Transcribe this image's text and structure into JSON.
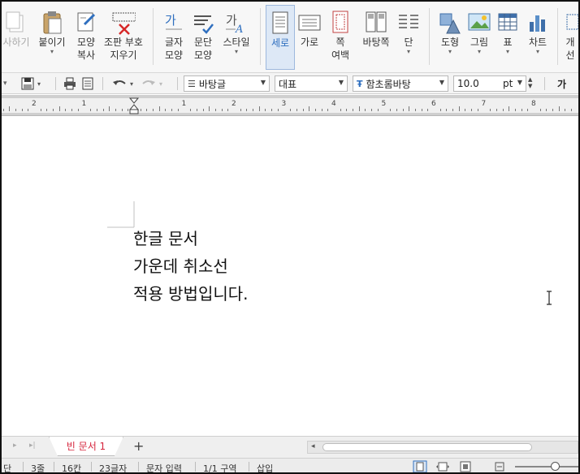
{
  "ribbon": {
    "buttons": [
      {
        "label": "사하기",
        "label2": ""
      },
      {
        "label": "붙이기",
        "label2": ""
      },
      {
        "label": "모양",
        "label2": "복사"
      },
      {
        "label": "조판 부호",
        "label2": "지우기"
      },
      {
        "label": "글자",
        "label2": "모양"
      },
      {
        "label": "문단",
        "label2": "모양"
      },
      {
        "label": "스타일",
        "label2": ""
      },
      {
        "label": "세로",
        "label2": ""
      },
      {
        "label": "가로",
        "label2": ""
      },
      {
        "label": "쪽",
        "label2": "여백"
      },
      {
        "label": "바탕쪽",
        "label2": ""
      },
      {
        "label": "단",
        "label2": ""
      },
      {
        "label": "도형",
        "label2": ""
      },
      {
        "label": "그림",
        "label2": ""
      },
      {
        "label": "표",
        "label2": ""
      },
      {
        "label": "차트",
        "label2": ""
      },
      {
        "label": "개",
        "label2": "선"
      }
    ],
    "active": "세로"
  },
  "toolbar": {
    "style_combo": "바탕글",
    "lang_combo": "대표",
    "font_combo": "함초롬바탕",
    "size_value": "10.0",
    "size_unit": "pt",
    "bold_char": "가"
  },
  "ruler": {
    "numbers": [
      "2",
      "1",
      "1",
      "2",
      "3",
      "4",
      "5",
      "6",
      "7",
      "8"
    ]
  },
  "document": {
    "lines": [
      "한글 문서",
      "가운데 취소선",
      "적용 방법입니다."
    ]
  },
  "tabs": {
    "active_tab": "빈 문서 1",
    "add_symbol": "+"
  },
  "status": {
    "items": [
      "단",
      "3줄",
      "16칸",
      "23글자",
      "문자 입력",
      "1/1 구역",
      "삽입"
    ]
  },
  "colors": {
    "accent": "#2f6fbf",
    "tab_text": "#d6253d"
  }
}
